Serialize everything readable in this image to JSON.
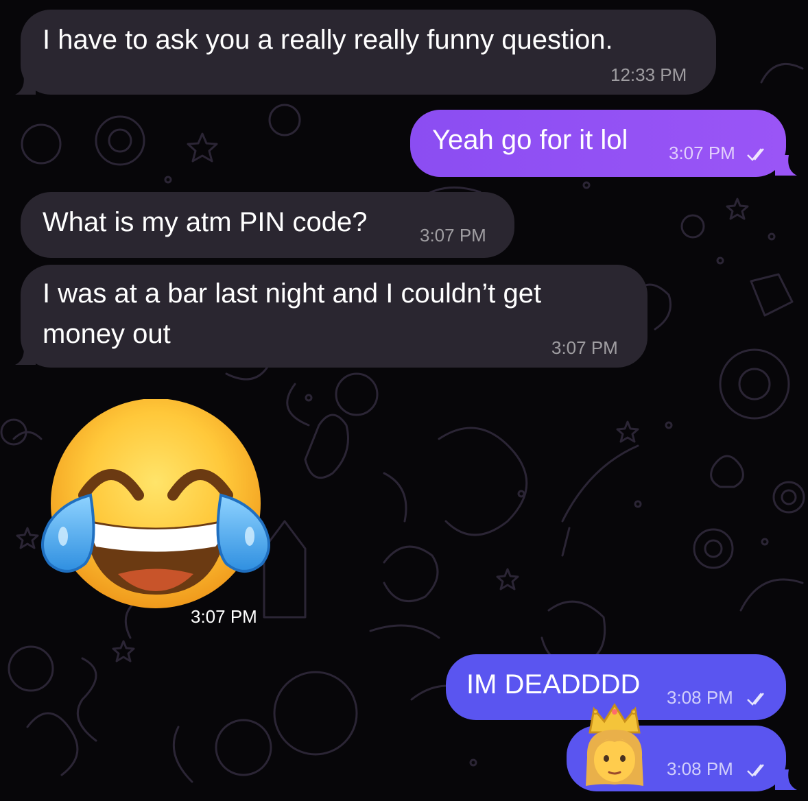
{
  "chat": {
    "messages": [
      {
        "id": "m1",
        "direction": "incoming",
        "text": "I have to ask you a really really funny question.",
        "time": "12:33 PM"
      },
      {
        "id": "m2",
        "direction": "outgoing",
        "text": "Yeah go for it lol",
        "time": "3:07 PM",
        "status_icon": "double-check-icon"
      },
      {
        "id": "m3",
        "direction": "incoming",
        "text": "What is my atm PIN code?",
        "time": "3:07 PM"
      },
      {
        "id": "m4",
        "direction": "incoming",
        "text_line1": "I was at a bar last night and I couldn’t get",
        "text_line2": "money out",
        "time": "3:07 PM"
      },
      {
        "id": "m5",
        "direction": "incoming",
        "emoji": "face-with-tears-of-joy-icon",
        "time": "3:07 PM"
      },
      {
        "id": "m6",
        "direction": "outgoing",
        "text": "IM DEADDDD",
        "time": "3:08 PM",
        "status_icon": "double-check-icon"
      },
      {
        "id": "m7",
        "direction": "outgoing",
        "emoji": "princess-icon",
        "time": "3:08 PM",
        "status_icon": "double-check-icon"
      }
    ]
  },
  "colors": {
    "background": "#070609",
    "incoming_bubble": "#2a2630",
    "outgoing_purple": "#9a55f6",
    "outgoing_blue": "#5a55f0",
    "doodle_stroke": "#2a2433"
  }
}
